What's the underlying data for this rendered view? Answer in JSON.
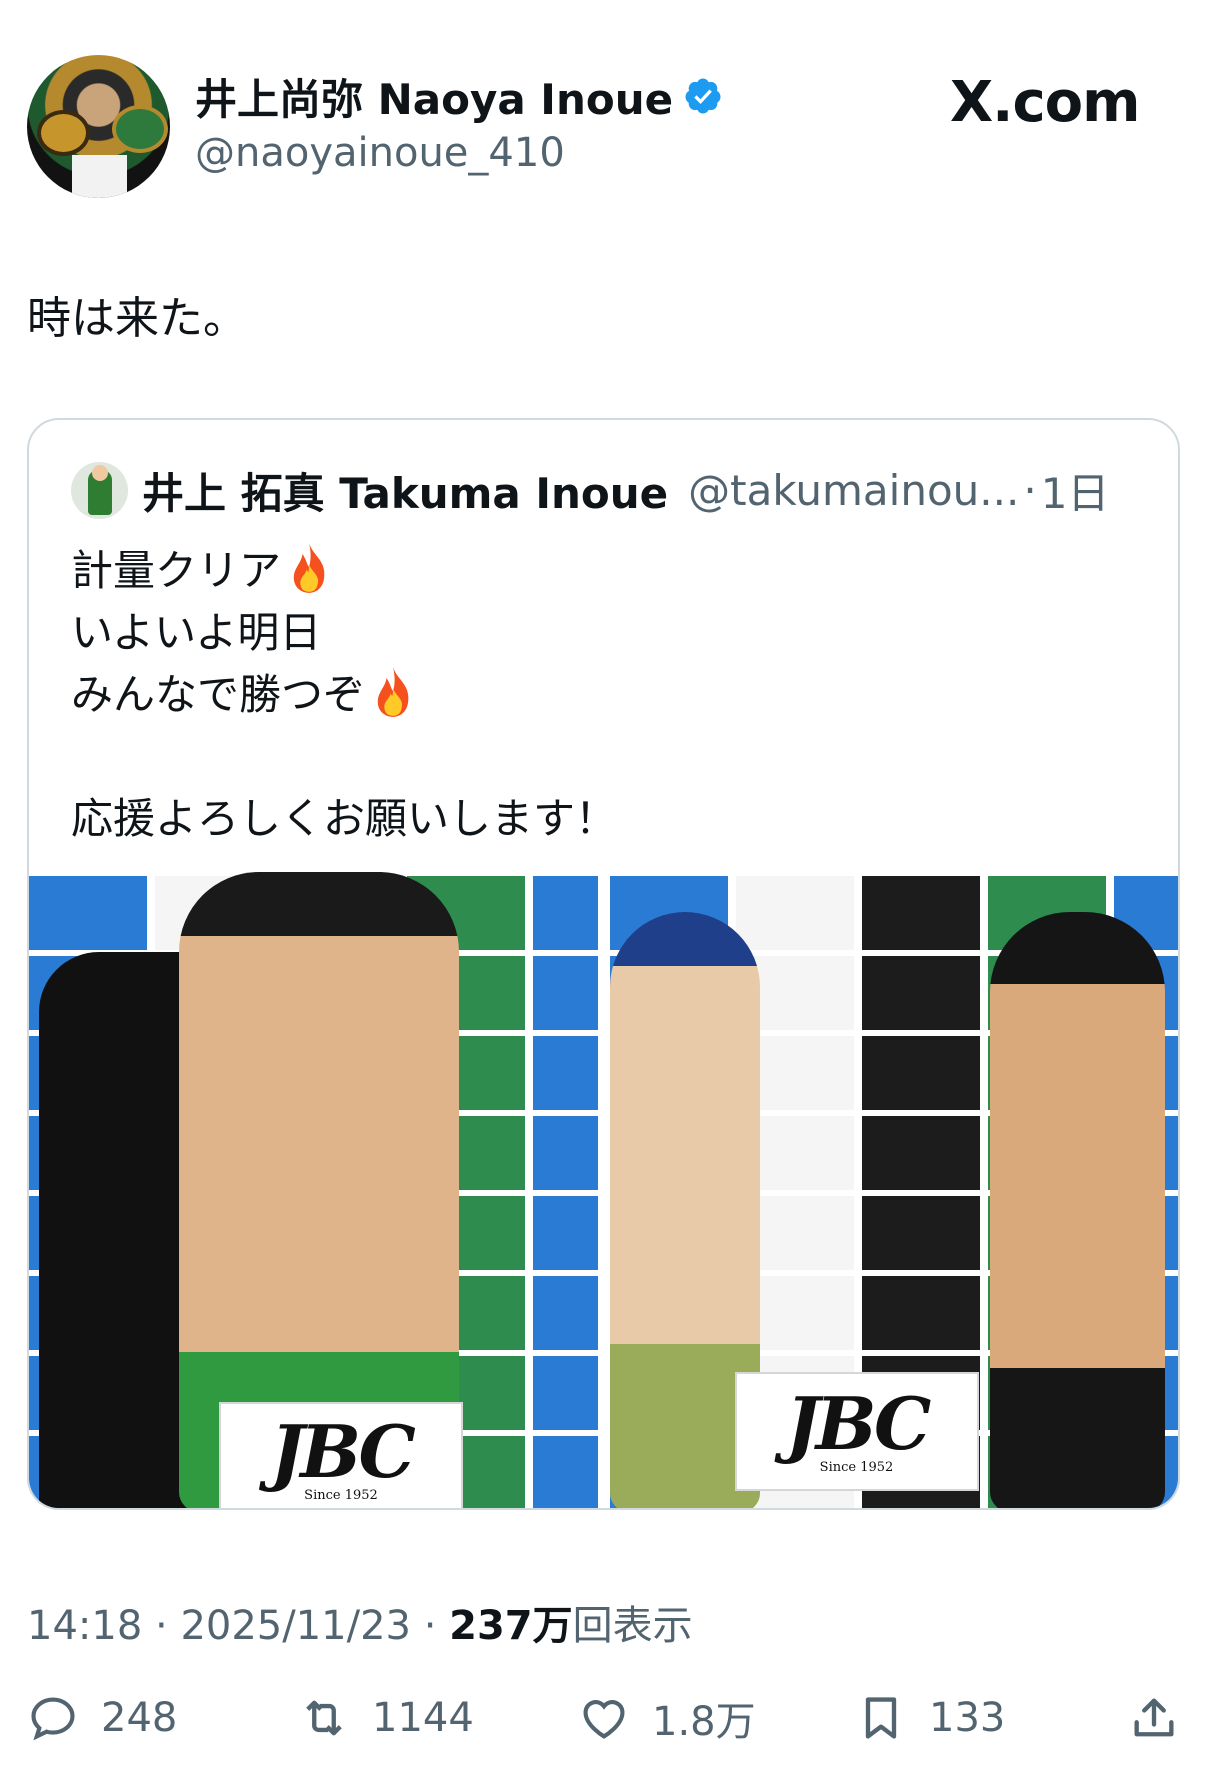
{
  "header": {
    "display_name": "井上尚弥  Naoya Inoue",
    "handle": "@naoyainoue_410",
    "site": "X.com"
  },
  "tweet": {
    "text": "時は来た。"
  },
  "quote": {
    "display_name": "井上 拓真  Takuma Inoue",
    "handle": "@takumainou...",
    "separator": "·",
    "time": "1日",
    "lines": [
      "計量クリア",
      "いよいよ明日",
      "みんなで勝つぞ",
      "",
      "応援よろしくお願いします！"
    ],
    "photos": [
      {
        "sign_main": "JBC",
        "sign_since": "Since 1952"
      },
      {
        "sign_main": "JBC",
        "sign_since": "Since 1952"
      }
    ]
  },
  "meta": {
    "time": "14:18",
    "dot1": " · ",
    "date": "2025/11/23",
    "dot2": " · ",
    "views": "237万",
    "views_label": "回表示"
  },
  "actions": {
    "replies": "248",
    "reposts": "1144",
    "likes": "1.8万",
    "bookmarks": "133"
  },
  "colors": {
    "verified": "#1d9bf0",
    "muted": "#536471",
    "border": "#cfd9de"
  }
}
